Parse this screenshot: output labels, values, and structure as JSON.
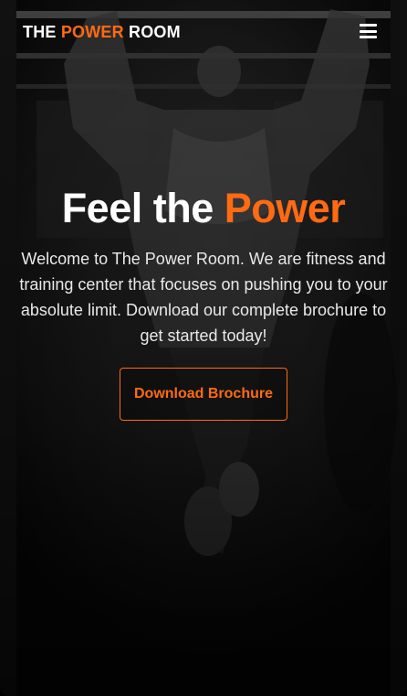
{
  "brand": {
    "part1": "THE ",
    "part2": "POWER",
    "part3": " ROOM"
  },
  "nav": {
    "menu_icon": "hamburger-menu-icon"
  },
  "hero": {
    "headline_part1": "Feel the ",
    "headline_part2": "Power",
    "lead": "Welcome to The Power Room. We are fitness and training center that focuses on pushing you to your absolute limit. Download our complete brochure to get started today!",
    "cta_label": "Download Brochure"
  },
  "colors": {
    "accent": "#ff6a13",
    "text": "#ffffff",
    "background": "#000000"
  }
}
